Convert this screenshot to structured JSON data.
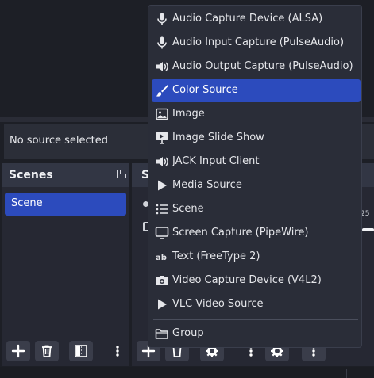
{
  "context_bar": {
    "no_source_text": "No source selected"
  },
  "scenes_dock": {
    "title": "Scenes",
    "items": [
      "Scene"
    ]
  },
  "sources_dock": {
    "title_partial": "So"
  },
  "mixer": {
    "tick_label": "25"
  },
  "menu": {
    "items": [
      {
        "label": "Audio Capture Device (ALSA)",
        "icon": "microphone-icon"
      },
      {
        "label": "Audio Input Capture (PulseAudio)",
        "icon": "microphone-icon"
      },
      {
        "label": "Audio Output Capture (PulseAudio)",
        "icon": "speaker-icon"
      },
      {
        "label": "Color Source",
        "icon": "paintbrush-icon",
        "active": true
      },
      {
        "label": "Image",
        "icon": "image-icon"
      },
      {
        "label": "Image Slide Show",
        "icon": "slideshow-icon"
      },
      {
        "label": "JACK Input Client",
        "icon": "speaker-icon"
      },
      {
        "label": "Media Source",
        "icon": "play-icon"
      },
      {
        "label": "Scene",
        "icon": "list-icon"
      },
      {
        "label": "Screen Capture (PipeWire)",
        "icon": "monitor-icon"
      },
      {
        "label": "Text (FreeType 2)",
        "icon": "text-icon"
      },
      {
        "label": "Video Capture Device (V4L2)",
        "icon": "camera-icon"
      },
      {
        "label": "VLC Video Source",
        "icon": "play-icon"
      }
    ],
    "group_label": "Group",
    "group_icon": "folder-icon"
  },
  "colors": {
    "accent": "#2c4bbd",
    "background": "#1d1f26",
    "dock_header": "#323644",
    "menu_bg": "#2a2d38"
  }
}
